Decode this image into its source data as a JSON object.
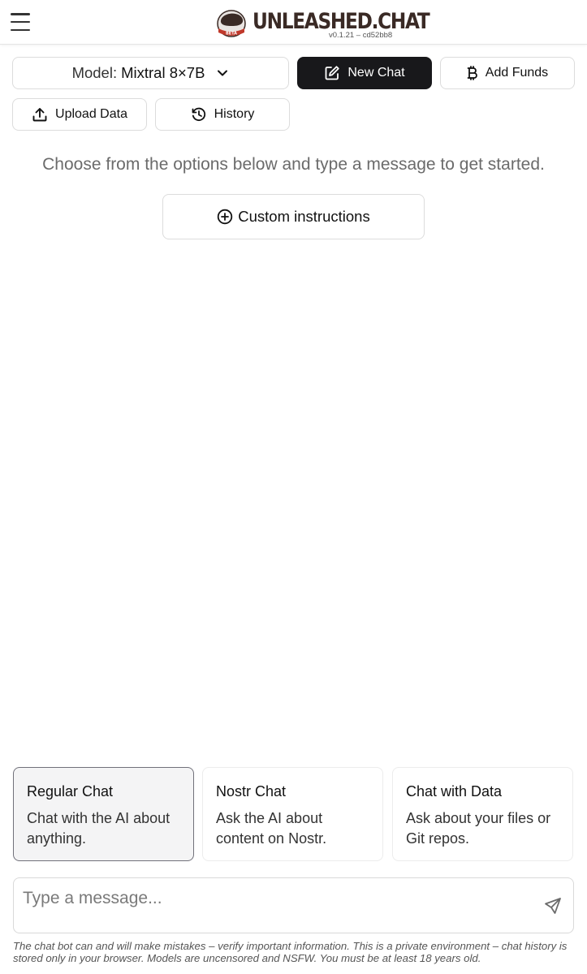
{
  "header": {
    "brand_name": "UNLEASHED.CHAT",
    "version": "v0.1.21 – cd52bb8",
    "beta_badge": "BETA"
  },
  "toolbar": {
    "model_label": "Model:",
    "model_value": "Mixtral 8×7B",
    "new_chat_label": "New Chat",
    "add_funds_label": "Add Funds",
    "upload_data_label": "Upload Data",
    "history_label": "History"
  },
  "main": {
    "intro_text": "Choose from the options below and type a message to get started.",
    "custom_instructions_label": "Custom instructions"
  },
  "chat_modes": [
    {
      "title": "Regular Chat",
      "description": "Chat with the AI about anything.",
      "selected": true
    },
    {
      "title": "Nostr Chat",
      "description": "Ask the AI about content on Nostr.",
      "selected": false
    },
    {
      "title": "Chat with Data",
      "description": "Ask about your files or Git repos.",
      "selected": false
    }
  ],
  "composer": {
    "placeholder": "Type a message...",
    "value": ""
  },
  "footer": {
    "disclaimer": "The chat bot can and will make mistakes – verify important information. This is a private environment – chat history is stored only in your browser. Models are uncensored and NSFW. You must be at least 18 years old."
  },
  "icons": {
    "menu": "hamburger-icon",
    "chevron": "chevron-down-icon",
    "new_chat": "edit-icon",
    "add_funds": "bitcoin-icon",
    "upload": "upload-icon",
    "history": "history-icon",
    "custom": "plus-circle-icon",
    "send": "send-icon"
  },
  "colors": {
    "primary_button_bg": "#18181b",
    "brand_text": "#3a2a25",
    "logo_red": "#c0392b",
    "selected_card_bg": "#f4f4f5"
  }
}
